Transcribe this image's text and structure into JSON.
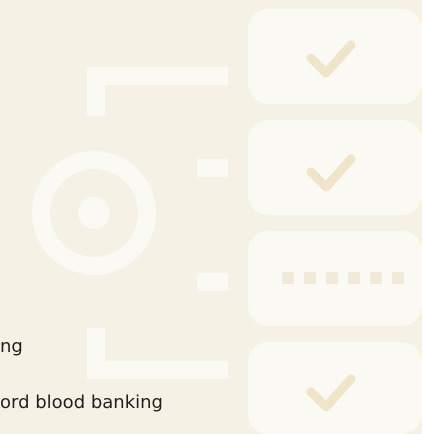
{
  "colors": {
    "background": "#f5f1e5",
    "card": "#fbf9f4",
    "muted_shape": "#f1ead8",
    "check": "#f0e5c9"
  },
  "icons": {
    "cards": [
      "check-icon",
      "check-icon",
      "dots-icon",
      "check-icon"
    ],
    "target": "target-icon"
  },
  "text": {
    "line_1": "ng",
    "line_2": "ord blood banking"
  }
}
